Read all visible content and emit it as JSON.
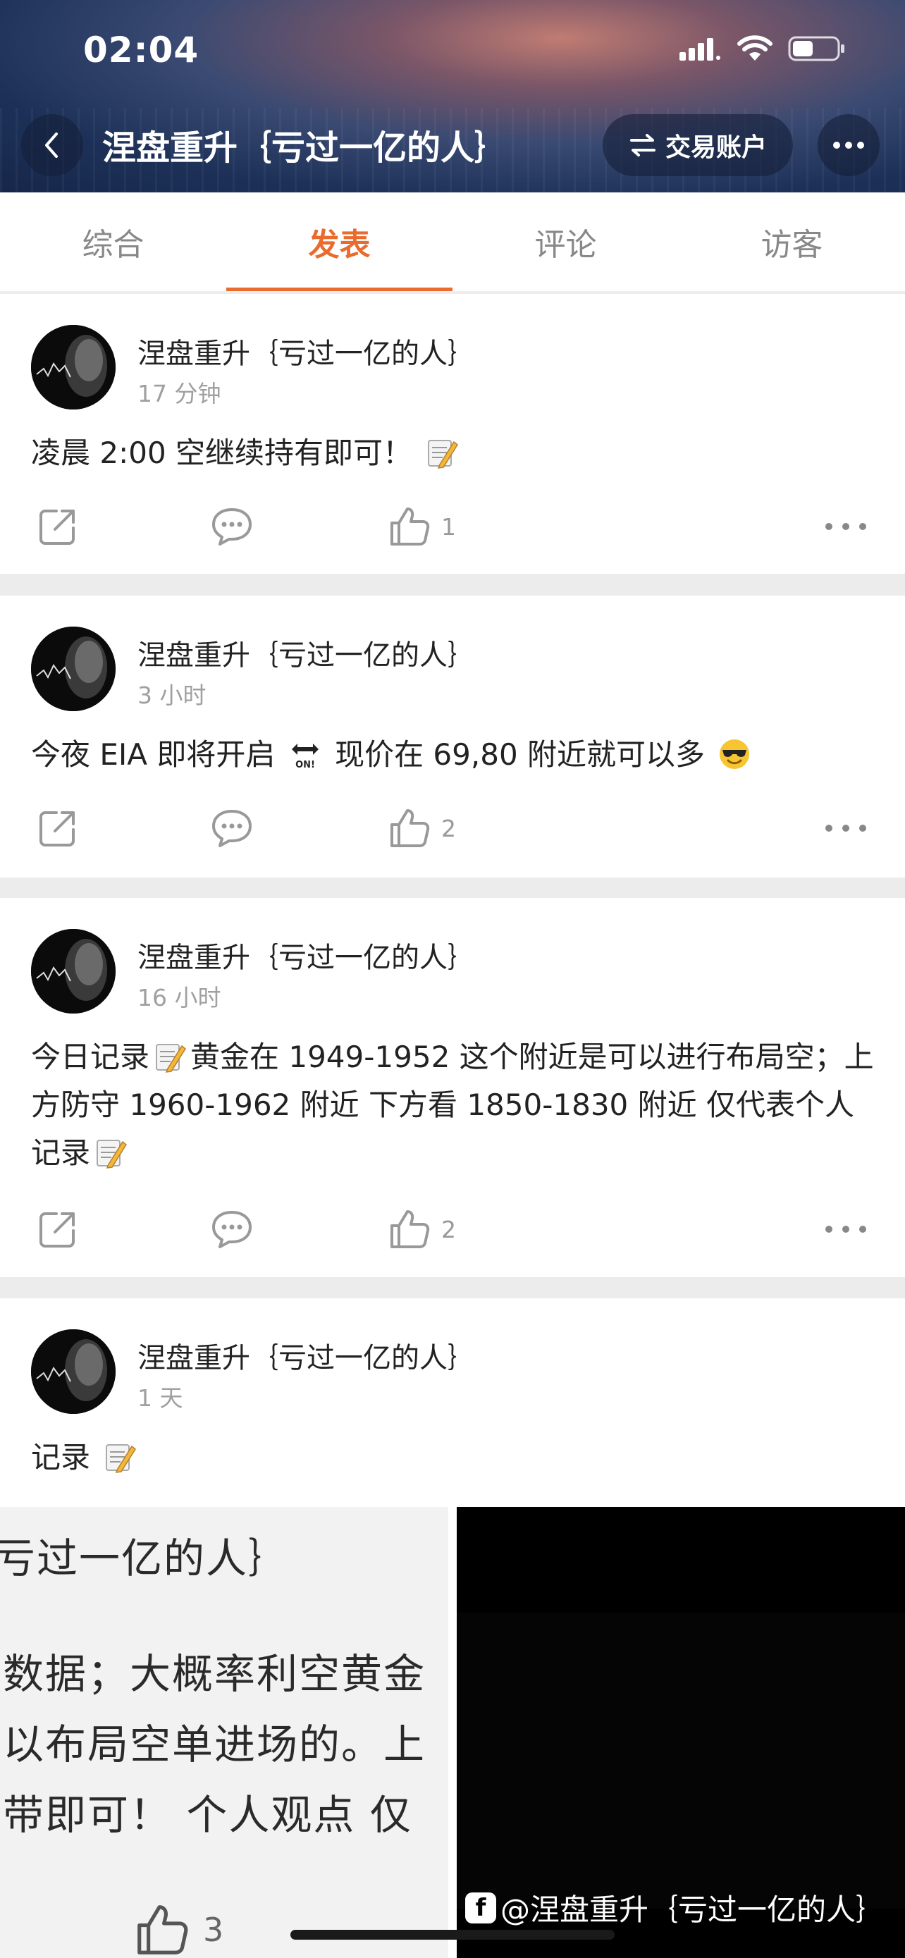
{
  "status_bar": {
    "time": "02:04"
  },
  "header": {
    "title": "涅盘重升｛亏过一亿的人｝",
    "trade_button_label": "交易账户"
  },
  "tabs": [
    {
      "label": "综合",
      "active": false
    },
    {
      "label": "发表",
      "active": true
    },
    {
      "label": "评论",
      "active": false
    },
    {
      "label": "访客",
      "active": false
    }
  ],
  "posts": [
    {
      "author": "涅盘重升｛亏过一亿的人｝",
      "time": "17 分钟",
      "text": "凌晨 2:00 空继续持有即可！",
      "likes": "1"
    },
    {
      "author": "涅盘重升｛亏过一亿的人｝",
      "time": "3 小时",
      "text_before": "今夜 EIA 即将开启",
      "text_after": "现价在 69,80 附近就可以多",
      "likes": "2"
    },
    {
      "author": "涅盘重升｛亏过一亿的人｝",
      "time": "16 小时",
      "text_part1": "今日记录",
      "text_part2": "黄金在 1949-1952 这个附近是可以进行布局空；上方防守 1960-1962 附近  下方看 1850-1830 附近  仅代表个人记录",
      "likes": "2"
    },
    {
      "author": "涅盘重升｛亏过一亿的人｝",
      "time": "1 天",
      "text": "记录"
    }
  ],
  "preview_image": {
    "lines": [
      "亏过一亿的人｝",
      "数据；大概率利空黄金",
      "以布局空单进场的。上",
      "带即可！  个人观点 仅"
    ],
    "likes": "3"
  },
  "watermark": "@涅盘重升｛亏过一亿的人｝",
  "colors": {
    "accent": "#ea6b2e",
    "header_dark": "#1d3158"
  }
}
